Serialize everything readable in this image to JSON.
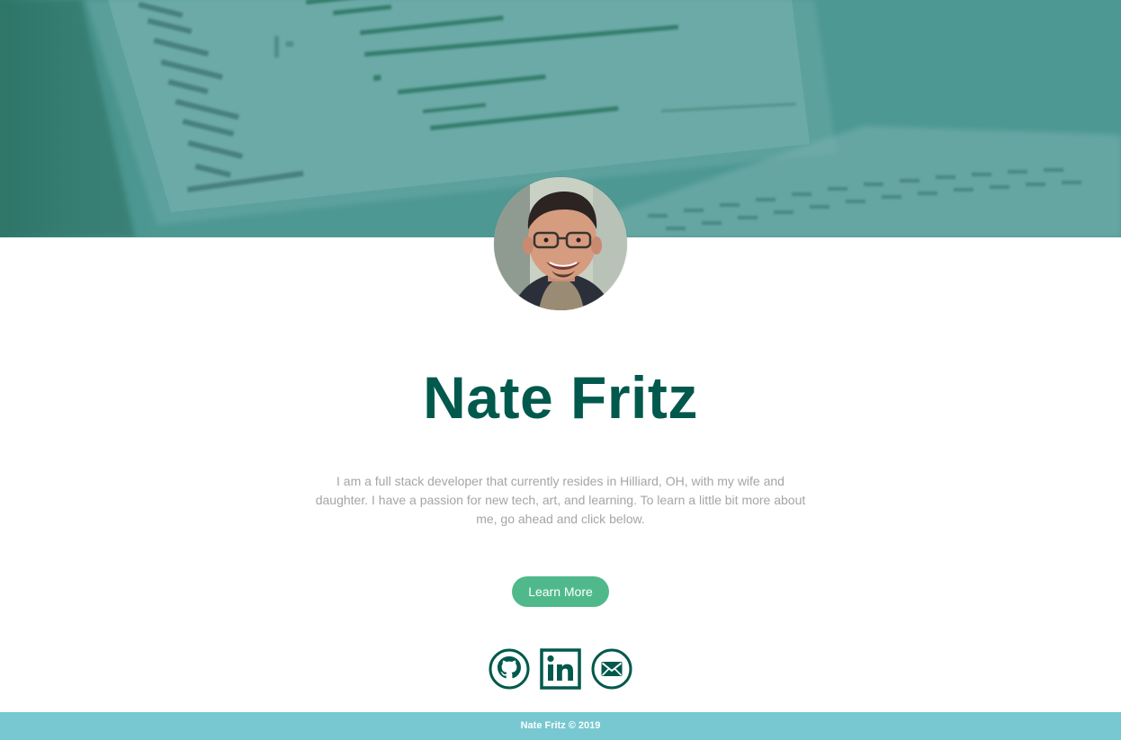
{
  "profile": {
    "name": "Nate Fritz",
    "bio": "I am a full stack developer that currently resides in Hilliard, OH, with my wife and daughter. I have a passion for new tech, art, and learning. To learn a little bit more about me, go ahead and click below."
  },
  "cta": {
    "label": "Learn More"
  },
  "social": [
    {
      "name": "github",
      "icon": "github-icon"
    },
    {
      "name": "linkedin",
      "icon": "linkedin-icon"
    },
    {
      "name": "email",
      "icon": "envelope-icon"
    }
  ],
  "footer": {
    "text": "Nate Fritz © 2019"
  },
  "colors": {
    "primary": "#00594c",
    "accent": "#50b98b",
    "footer": "#77c8d1",
    "bio_text": "#a5a5a5",
    "hero_tint": "#4f9a96"
  }
}
